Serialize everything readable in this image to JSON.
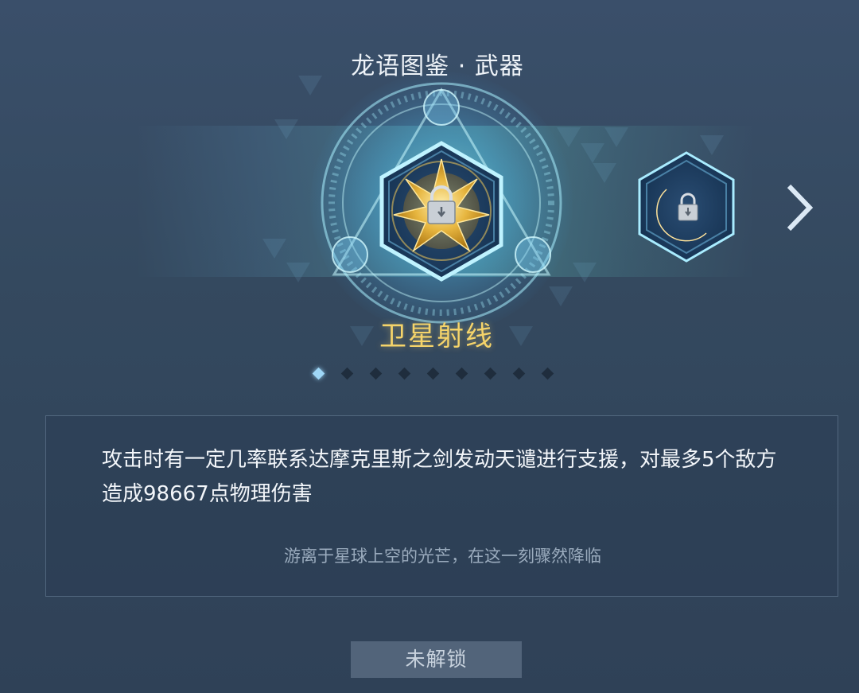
{
  "header": {
    "title": "龙语图鉴 · 武器"
  },
  "carousel": {
    "current_item": {
      "name": "卫星射线",
      "icon": "satellite-ray-weapon-icon",
      "locked": true
    },
    "next_item": {
      "icon": "crescent-weapon-icon",
      "locked": true
    },
    "next_arrow_icon": "chevron-right-icon",
    "page_count": 9,
    "active_page": 1
  },
  "description": {
    "effect": "攻击时有一定几率联系达摩克里斯之剑发动天谴进行支援，对最多5个敌方造成98667点物理伤害",
    "flavor": "游离于星球上空的光芒，在这一刻骤然降临"
  },
  "action": {
    "button_label": "未解锁"
  },
  "colors": {
    "accent_gold": "#f5d46a",
    "accent_cyan": "#7fe3ff",
    "background": "#34495f"
  }
}
